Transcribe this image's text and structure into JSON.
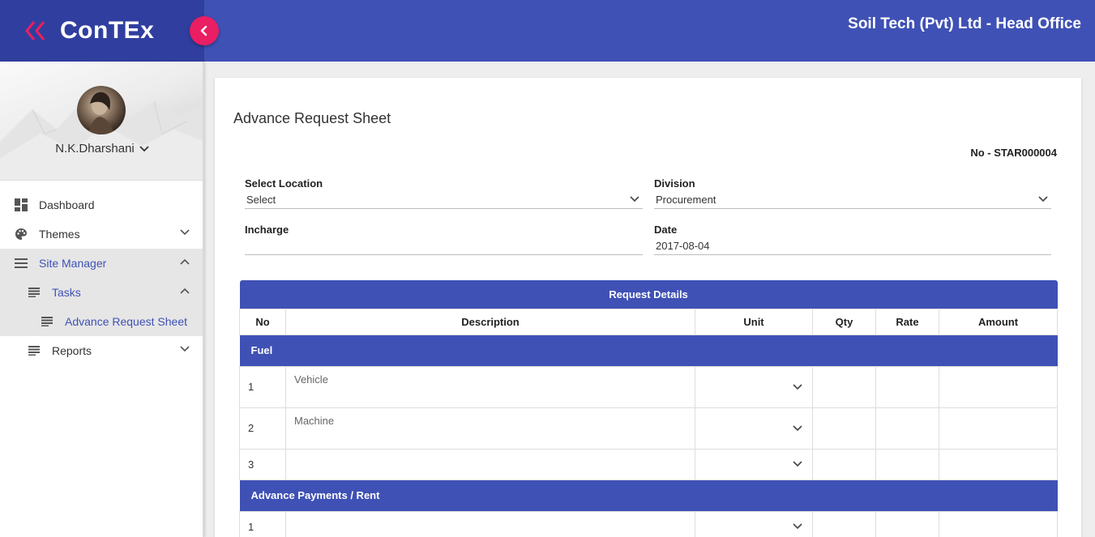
{
  "app": {
    "brand_name": "ConTEx",
    "company": "Soil Tech (Pvt) Ltd - Head Office",
    "accent": "#3f51b5",
    "accent_dark": "#303f9f",
    "fab_color": "#e91e63"
  },
  "user": {
    "name": "N.K.Dharshani"
  },
  "sidebar": {
    "items": [
      {
        "label": "Dashboard",
        "icon": "dashboard-icon"
      },
      {
        "label": "Themes",
        "icon": "palette-icon"
      },
      {
        "label": "Site Manager",
        "icon": "menu-lines-icon"
      },
      {
        "label": "Tasks",
        "icon": "list-icon"
      },
      {
        "label": "Advance Request Sheet",
        "icon": "list-icon"
      },
      {
        "label": "Reports",
        "icon": "list-icon"
      }
    ]
  },
  "page": {
    "title": "Advance Request Sheet",
    "doc_no": "No - STAR000004"
  },
  "form": {
    "location": {
      "label": "Select Location",
      "value": "Select"
    },
    "division": {
      "label": "Division",
      "value": "Procurement"
    },
    "incharge": {
      "label": "Incharge",
      "value": ""
    },
    "date": {
      "label": "Date",
      "value": "2017-08-04"
    }
  },
  "table": {
    "title": "Request Details",
    "columns": [
      "No",
      "Description",
      "Unit",
      "Qty",
      "Rate",
      "Amount"
    ],
    "sections": [
      {
        "name": "Fuel",
        "rows": [
          {
            "no": "1",
            "description": "Vehicle"
          },
          {
            "no": "2",
            "description": "Machine"
          },
          {
            "no": "3",
            "description": ""
          }
        ]
      },
      {
        "name": "Advance Payments / Rent",
        "rows": [
          {
            "no": "1",
            "description": ""
          }
        ]
      }
    ]
  }
}
